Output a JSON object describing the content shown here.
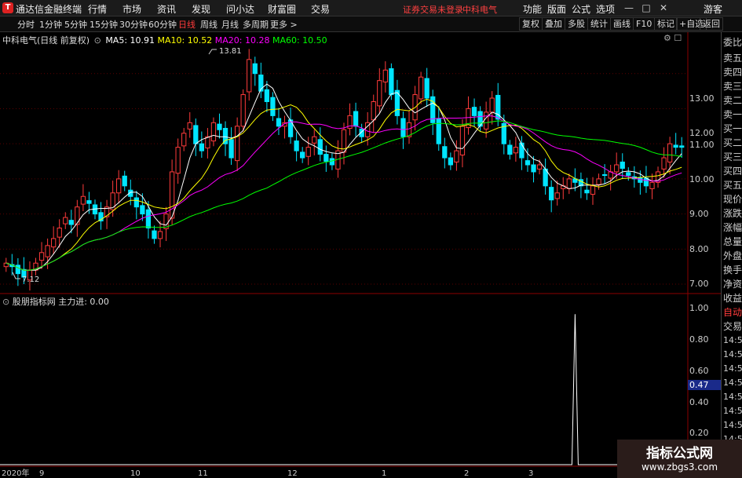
{
  "app": {
    "name": "通达信金融终端",
    "logo_char": "T"
  },
  "menu": [
    "行情",
    "市场",
    "资讯",
    "发现",
    "问小达",
    "财富圈",
    "交易"
  ],
  "warning_text": "证券交易未登录",
  "stock_title": "中科电气",
  "menu_right": [
    "功能",
    "版面",
    "公式",
    "选项"
  ],
  "window_controls": {
    "minimize_icon": "minimize-icon",
    "restore_icon": "restore-icon",
    "close_icon": "close-icon"
  },
  "guest_label": "游客",
  "toolbar": {
    "periods": [
      "分时",
      "1分钟",
      "5分钟",
      "15分钟",
      "30分钟",
      "60分钟",
      "日线",
      "周线",
      "月线",
      "多周期",
      "更多 >"
    ],
    "active_period": "日线",
    "right": [
      "复权",
      "叠加",
      "多股",
      "统计",
      "画线",
      "F10",
      "标记",
      "+自选",
      "返回"
    ]
  },
  "main_legend": {
    "stock": "中科电气(日线 前复权)",
    "ma5": "MA5: 10.91",
    "ma10": "MA10: 10.52",
    "ma20": "MA20: 10.28",
    "ma60": "MA60: 10.50",
    "ma5_color": "#ffffff",
    "ma10_color": "#ffff00",
    "ma20_color": "#ff00ff",
    "ma60_color": "#00ff00"
  },
  "sub_legend": {
    "name": "股朋指标网",
    "label": "主力进: 0.00"
  },
  "price_axis": [
    "13.00",
    "12.00",
    "11.00",
    "10.00",
    "9.00",
    "8.00",
    "7.00"
  ],
  "indicator_axis": [
    "1.00",
    "0.80",
    "0.60",
    "0.40",
    "0.20"
  ],
  "indicator_current": "0.47",
  "annotations": {
    "high": "13.81",
    "low": "7.12"
  },
  "date_axis": [
    "2020年",
    "9",
    "10",
    "11",
    "12",
    "1",
    "2",
    "3"
  ],
  "right_panel": {
    "top_labels": [
      "委比",
      "卖五",
      "卖四",
      "卖三",
      "卖二",
      "卖一",
      "买一",
      "买二",
      "买三",
      "买四",
      "买五",
      "现价",
      "涨跌",
      "涨幅",
      "总量",
      "外盘",
      "换手",
      "净资",
      "收益"
    ],
    "auto_label": "自动",
    "trade_label": "交易",
    "times": [
      "14:56",
      "14:56",
      "14:56",
      "14:56",
      "14:56",
      "14:56",
      "14:56",
      "14:56"
    ]
  },
  "watermark": {
    "title": "指标公式网",
    "url": "www.zbgs3.com"
  },
  "colors": {
    "up": "#ff3b3b",
    "down": "#00e5ff",
    "grid": "#8b0000",
    "accent": "#ff3b3b"
  },
  "chart_data": {
    "type": "candlestick",
    "price_range": [
      6.8,
      14.0
    ],
    "candles_close_path": [
      7.6,
      7.5,
      7.3,
      7.2,
      7.4,
      7.6,
      7.9,
      8.1,
      8.3,
      8.6,
      8.9,
      8.7,
      9.2,
      9.5,
      9.3,
      9.0,
      8.8,
      9.2,
      9.6,
      10.0,
      9.8,
      9.5,
      9.2,
      9.0,
      8.6,
      8.3,
      8.5,
      9.0,
      10.2,
      10.9,
      11.3,
      11.6,
      11.0,
      10.8,
      11.2,
      11.6,
      11.4,
      11.0,
      10.6,
      11.5,
      12.4,
      13.4,
      13.0,
      12.5,
      12.2,
      11.8,
      11.5,
      11.6,
      11.2,
      10.8,
      10.6,
      10.9,
      11.2,
      10.7,
      10.5,
      10.4,
      10.8,
      11.4,
      11.8,
      11.5,
      11.2,
      11.6,
      12.2,
      12.8,
      13.1,
      12.4,
      11.8,
      11.2,
      11.6,
      12.4,
      12.9,
      12.3,
      11.6,
      11.0,
      10.6,
      10.4,
      10.8,
      11.5,
      12.0,
      11.8,
      11.5,
      11.9,
      12.3,
      11.7,
      11.0,
      10.7,
      10.9,
      10.6,
      10.4,
      10.2,
      10.4,
      9.8,
      9.4,
      9.6,
      9.8,
      10.0,
      9.9,
      9.8,
      9.6,
      9.8,
      10.0,
      10.1,
      10.2,
      10.4,
      10.3,
      10.1,
      10.0,
      9.9,
      9.8,
      9.9,
      10.2,
      10.6,
      11.0,
      10.9,
      10.9
    ],
    "indicator": {
      "name": "主力进",
      "range": [
        0,
        1.1
      ],
      "spike_at_index": 96,
      "spike_value": 1.0,
      "current": 0.0
    }
  }
}
